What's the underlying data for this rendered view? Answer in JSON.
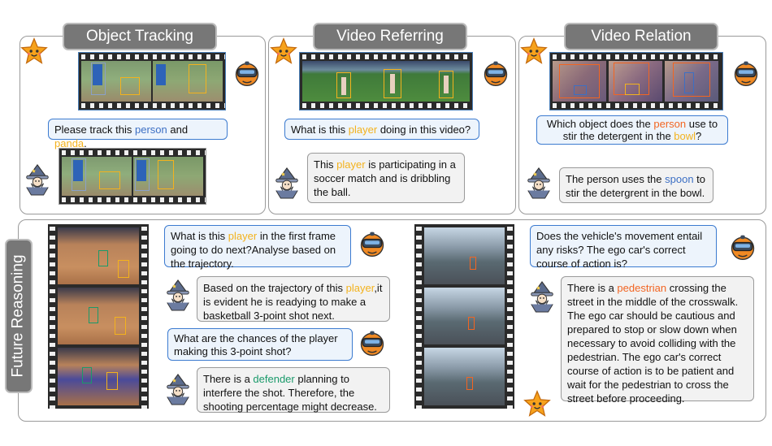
{
  "panels": {
    "object_tracking": {
      "title": "Object Tracking",
      "question": {
        "pre": "Please track this ",
        "t1": "person",
        "mid": " and ",
        "t2": "panda",
        "post": "."
      }
    },
    "video_referring": {
      "title": "Video Referring",
      "question": {
        "pre": "What is this ",
        "t1": "player",
        "post": " doing in this video?"
      },
      "answer": {
        "pre": "This ",
        "t1": "player",
        "post": " is participating in a soccer match and is dribbling the ball."
      }
    },
    "video_relation": {
      "title": "Video Relation",
      "question": {
        "pre": "Which object does the ",
        "t1": "person",
        "mid": " use to stir the detergent in the ",
        "t2": "bowl",
        "post": "?"
      },
      "answer": {
        "pre": "The person uses the ",
        "t1": "spoon",
        "post": " to stir the detergrent in the bowl."
      }
    },
    "future_reasoning": {
      "title": "Future Reasoning",
      "q1": {
        "pre": "What is this ",
        "t1": "player",
        "post": " in the first frame going to do next?Analyse based on the trajectory."
      },
      "a1": {
        "pre": "Based on the trajectory of this ",
        "t1": "player",
        "post": ",it is evident he is readying to make a basketball 3-point shot next."
      },
      "q2": {
        "text": "What are the chances of the player making this 3-point shot?"
      },
      "a2": {
        "pre": "There is a ",
        "t1": "defender",
        "post": " planning to interfere the shot. Therefore, the shooting percentage might decrease."
      },
      "q3": {
        "text": "Does the vehicle's movement entail any risks? The ego car's correct course of action is?"
      },
      "a3": {
        "pre": "There is a ",
        "t1": "pedestrian",
        "post": " crossing the street in the middle of the crosswalk. The ego car should be cautious and prepared to stop or slow down when necessary to avoid colliding with the pedestrian. The ego car's correct course of action is to be patient and wait for the pedestrian to cross the street before proceeding."
      }
    }
  },
  "icons": [
    "star-icon",
    "vr-headset-robot-icon",
    "wizard-icon"
  ],
  "colors": {
    "question_border": "#3c7bd0",
    "highlight_orange": "#f3b21d",
    "highlight_red": "#f26522",
    "highlight_blue": "#3c6fc4",
    "highlight_green": "#1a9a6a"
  }
}
